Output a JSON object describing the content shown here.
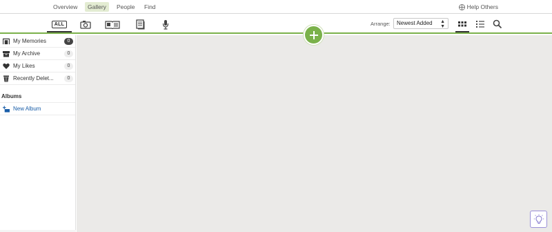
{
  "topnav": {
    "tabs": [
      {
        "label": "Overview",
        "active": false
      },
      {
        "label": "Gallery",
        "active": true
      },
      {
        "label": "People",
        "active": false
      },
      {
        "label": "Find",
        "active": false
      }
    ],
    "help_label": "Help Others"
  },
  "toolbar": {
    "filters": [
      {
        "name": "all",
        "label": "ALL",
        "active": true
      },
      {
        "name": "photos",
        "icon": "camera-icon"
      },
      {
        "name": "stories",
        "icon": "book-icon"
      },
      {
        "name": "documents",
        "icon": "document-icon"
      },
      {
        "name": "audio",
        "icon": "microphone-icon"
      }
    ],
    "add_icon": "plus-icon",
    "arrange_label": "Arrange:",
    "arrange_value": "Newest Added",
    "views": [
      {
        "name": "grid",
        "icon": "grid-icon",
        "active": true
      },
      {
        "name": "list",
        "icon": "list-icon",
        "active": false
      }
    ],
    "search_icon": "search-icon"
  },
  "sidebar": {
    "items": [
      {
        "label": "My Memories",
        "count": "0",
        "icon": "memories-icon"
      },
      {
        "label": "My Archive",
        "count": "0",
        "icon": "archive-icon"
      },
      {
        "label": "My Likes",
        "count": "0",
        "icon": "heart-icon"
      },
      {
        "label": "Recently Delet...",
        "count": "0",
        "icon": "trash-icon"
      }
    ],
    "albums_heading": "Albums",
    "new_album_label": "New Album"
  },
  "colors": {
    "accent_green": "#7ab14a",
    "active_tab_bg": "#e3ecd2",
    "link_blue": "#1a5ea8",
    "main_bg": "#ebeae8"
  },
  "idea_icon": "lightbulb-icon"
}
